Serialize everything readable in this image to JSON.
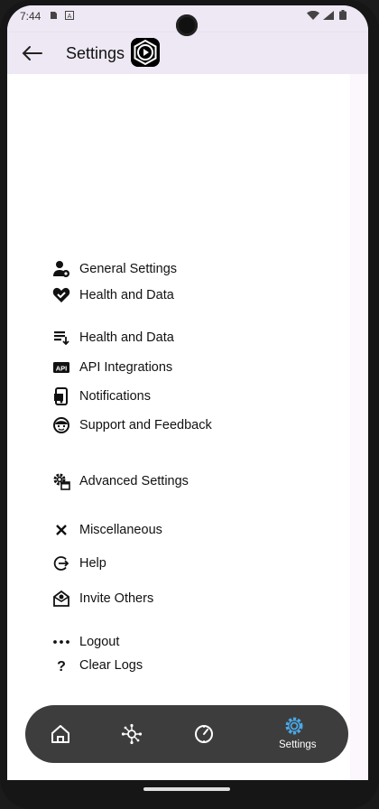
{
  "status": {
    "time": "7:44"
  },
  "appbar": {
    "title": "Settings"
  },
  "menu": [
    {
      "label": "General Settings",
      "icon": "person-gear-icon"
    },
    {
      "label": "Health and Data",
      "icon": "heart-check-icon"
    },
    {
      "label": "Health and Data",
      "icon": "list-download-icon"
    },
    {
      "label": "API Integrations",
      "icon": "api-icon"
    },
    {
      "label": "Notifications",
      "icon": "phone-notification-icon"
    },
    {
      "label": "Support and Feedback",
      "icon": "face-support-icon"
    },
    {
      "label": "Advanced Settings",
      "icon": "gear-window-icon"
    },
    {
      "label": "Miscellaneous",
      "icon": "close-x-icon"
    },
    {
      "label": "Help",
      "icon": "logout-circle-icon"
    },
    {
      "label": "Invite Others",
      "icon": "mail-invite-icon"
    },
    {
      "label": "Logout",
      "icon": "more-dots-icon"
    },
    {
      "label": "Clear Logs",
      "icon": "question-icon"
    }
  ],
  "bottom_nav": {
    "items": [
      {
        "icon": "home-icon"
      },
      {
        "icon": "network-icon"
      },
      {
        "icon": "timer-icon"
      },
      {
        "icon": "gear-icon",
        "label": "Settings",
        "active": true
      }
    ],
    "active_color": "#4aa8e8"
  }
}
